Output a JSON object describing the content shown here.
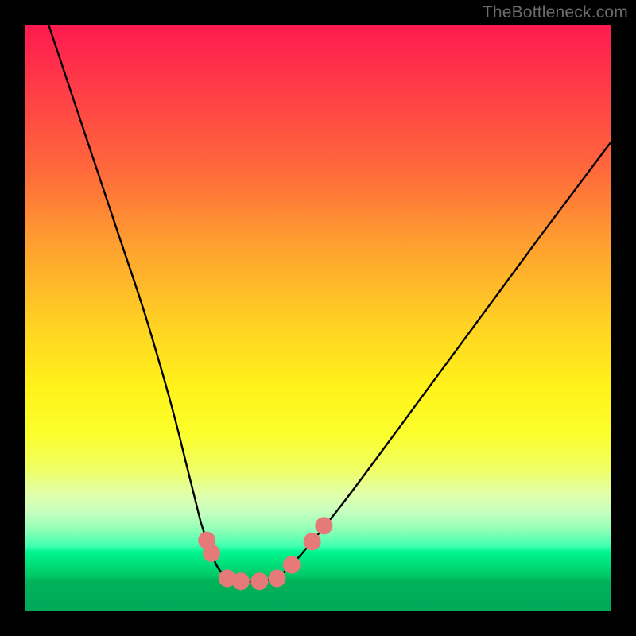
{
  "watermark": {
    "text": "TheBottleneck.com"
  },
  "chart_data": {
    "type": "line",
    "title": "",
    "xlabel": "",
    "ylabel": "",
    "xlim": [
      0,
      1
    ],
    "ylim": [
      0,
      1
    ],
    "series": [
      {
        "name": "left-branch",
        "x": [
          0.04,
          0.08,
          0.12,
          0.16,
          0.2,
          0.23,
          0.255,
          0.275,
          0.29,
          0.3,
          0.31,
          0.318,
          0.328,
          0.345,
          0.368
        ],
        "y": [
          1.0,
          0.88,
          0.76,
          0.64,
          0.52,
          0.42,
          0.33,
          0.25,
          0.19,
          0.15,
          0.12,
          0.098,
          0.075,
          0.055,
          0.05
        ]
      },
      {
        "name": "flat-bottom",
        "x": [
          0.345,
          0.368,
          0.4,
          0.43
        ],
        "y": [
          0.055,
          0.05,
          0.05,
          0.055
        ]
      },
      {
        "name": "right-branch",
        "x": [
          0.43,
          0.455,
          0.49,
          0.54,
          0.6,
          0.67,
          0.74,
          0.81,
          0.88,
          0.94,
          1.0
        ],
        "y": [
          0.055,
          0.078,
          0.118,
          0.18,
          0.26,
          0.355,
          0.45,
          0.545,
          0.64,
          0.72,
          0.8
        ]
      }
    ],
    "markers": [
      {
        "name": "left-pair-b",
        "x": 0.318,
        "y": 0.098
      },
      {
        "name": "left-pair-a",
        "x": 0.31,
        "y": 0.12
      },
      {
        "name": "bottom-1",
        "x": 0.345,
        "y": 0.055
      },
      {
        "name": "bottom-2",
        "x": 0.368,
        "y": 0.05
      },
      {
        "name": "bottom-3",
        "x": 0.4,
        "y": 0.05
      },
      {
        "name": "bottom-4",
        "x": 0.43,
        "y": 0.055
      },
      {
        "name": "right-pair-a",
        "x": 0.455,
        "y": 0.078
      },
      {
        "name": "right-pair-b",
        "x": 0.49,
        "y": 0.118
      },
      {
        "name": "right-pair-c",
        "x": 0.51,
        "y": 0.145
      }
    ],
    "colors": {
      "curve": "#000000",
      "marker_fill": "#e67a78",
      "marker_stroke": "#d25a58"
    }
  }
}
